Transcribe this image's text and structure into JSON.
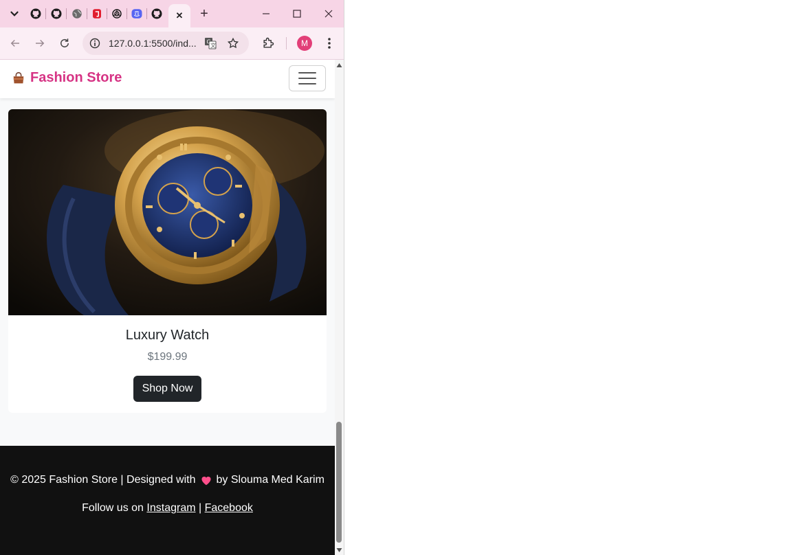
{
  "browser": {
    "tabs": [
      {
        "icon": "chevron-down-icon"
      },
      {
        "icon": "github-icon"
      },
      {
        "icon": "github-icon"
      },
      {
        "icon": "globe-icon"
      },
      {
        "icon": "red-app-icon"
      },
      {
        "icon": "openai-icon"
      },
      {
        "icon": "discord-icon"
      },
      {
        "icon": "github-icon"
      }
    ],
    "active_tab_close": "✕",
    "new_tab": "+",
    "url": "127.0.0.1:5500/ind...",
    "profile_initial": "M",
    "accent": "#f7d5e6"
  },
  "navbar": {
    "brand_icon": "handbag-icon",
    "brand": "Fashion Store",
    "brand_color": "#d63384"
  },
  "product": {
    "title": "Luxury Watch",
    "price": "$199.99",
    "button": "Shop Now",
    "image": "luxury-watch-photo"
  },
  "footer": {
    "copyright_prefix": "© 2025 Fashion Store | Designed with",
    "heart": "heart-icon",
    "copyright_suffix": "by Slouma Med Karim",
    "follow_prefix": "Follow us on",
    "instagram": "Instagram",
    "separator": "|",
    "facebook": "Facebook"
  }
}
